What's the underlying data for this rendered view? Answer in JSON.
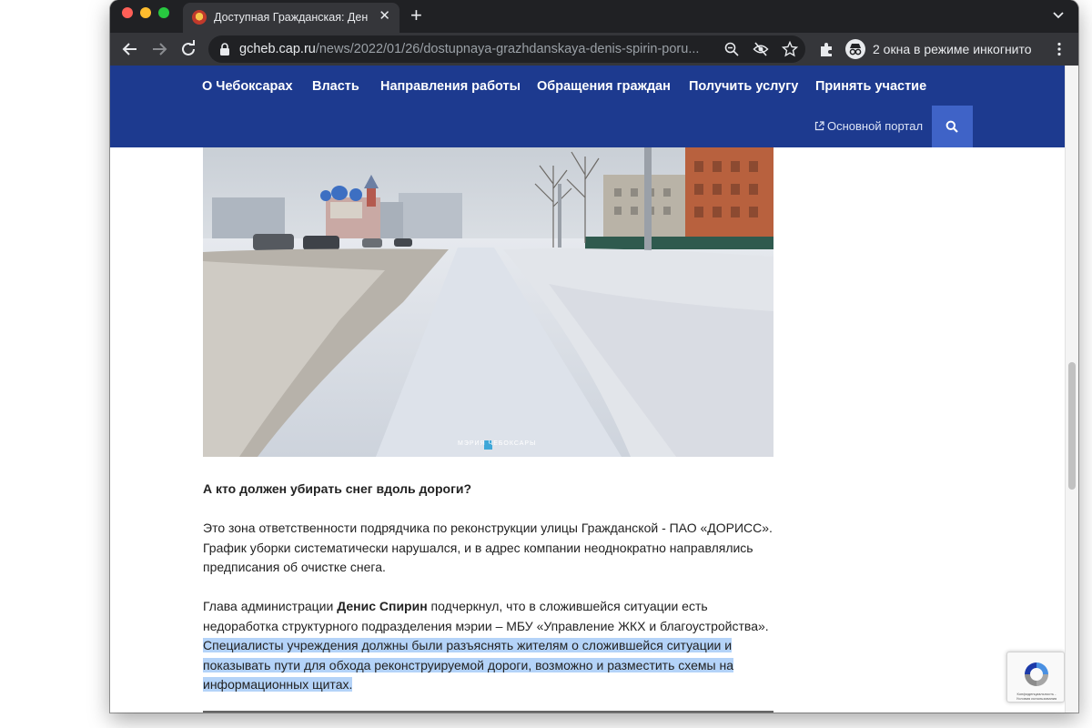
{
  "browser": {
    "tab_title": "Доступная Гражданская: Денис Спирин поручил",
    "url_host": "gcheb.cap.ru",
    "url_path": "/news/2022/01/26/dostupnaya-grazhdanskaya-denis-spirin-poru...",
    "incognito_label": "2 окна в режиме инкогнито",
    "icons": [
      "back-icon",
      "forward-icon",
      "reload-icon",
      "lock-icon",
      "zoom-icon",
      "eye-off-icon",
      "star-icon",
      "extensions-icon",
      "incognito-icon",
      "menu-icon"
    ]
  },
  "site_nav": {
    "items": [
      "О Чебоксарах",
      "Власть",
      "Направления работы",
      "Обращения граждан",
      "Получить услугу",
      "Принять участие"
    ],
    "portal_link": "Основной портал",
    "accent": "#1d3a8f"
  },
  "photo": {
    "watermark": "МЭРИЯ ЧЕБОКСАРЫ"
  },
  "article": {
    "question": "А кто должен убирать снег вдоль дороги?",
    "p1": "Это зона ответственности подрядчика по реконструкции улицы Гражданской - ПАО «ДОРИСС». График уборки систематически нарушался, и в адрес компании неоднократно направлялись предписания об очистке снега.",
    "p2_lead": "Глава администрации ",
    "p2_name": "Денис Спирин",
    "p2_rest": " подчеркнул, что в сложившейся ситуации есть недоработка структурного подразделения мэрии – МБУ «Управление ЖКХ и благоустройства». ",
    "p2_selected": "Специалисты учреждения должны были разъяснять жителям о сложившейся ситуации и показывать пути для обхода реконструируемой дороги, возможно и разместить схемы на информационных щитах."
  },
  "recaptcha": {
    "text": "Конфиденциальность - Условия использования"
  }
}
